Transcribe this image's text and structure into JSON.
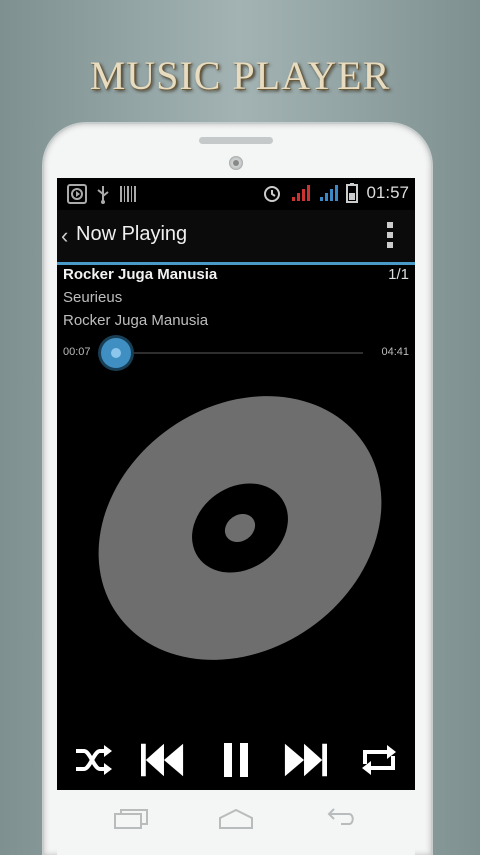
{
  "promo": {
    "title": "MUSIC PLAYER"
  },
  "status_bar": {
    "time": "01:57",
    "icons": [
      "media-playback-icon",
      "usb-icon",
      "barcode-icon",
      "alarm-icon",
      "signal-red-icon",
      "signal-blue-icon",
      "battery-icon"
    ]
  },
  "action_bar": {
    "back_icon": "chevron-left-icon",
    "title": "Now Playing",
    "menu_icon": "overflow-menu-icon"
  },
  "track": {
    "title": "Rocker Juga Manusia",
    "count": "1/1",
    "artist": "Seurieus",
    "album": "Rocker Juga Manusia"
  },
  "seek": {
    "elapsed": "00:07",
    "total": "04:41",
    "progress": 0.025
  },
  "controls": [
    "shuffle-icon",
    "previous-icon",
    "pause-icon",
    "next-icon",
    "repeat-icon"
  ],
  "nav_buttons": [
    "recent-apps-icon",
    "home-icon",
    "back-icon"
  ],
  "colors": {
    "accent": "#4a9ac7",
    "background": "#000000",
    "disc": "#6e6e6e"
  }
}
